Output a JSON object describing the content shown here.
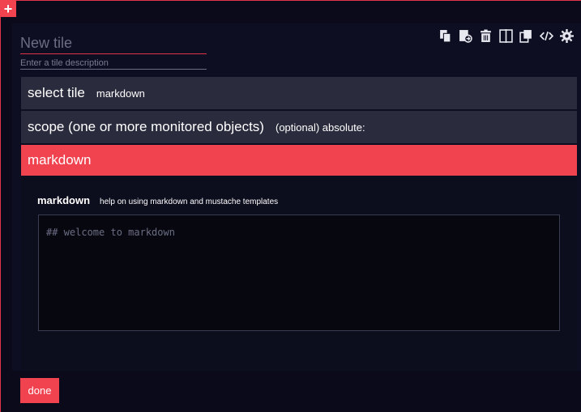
{
  "header": {
    "add_button_icon": "plus-icon",
    "accent_color": "#f0424f"
  },
  "tile": {
    "title_placeholder": "New tile",
    "description_placeholder": "Enter a tile description"
  },
  "toolbar": {
    "icons": [
      "copy-icon",
      "export-icon",
      "trash-icon",
      "split-icon",
      "duplicate-icon",
      "code-icon",
      "gear-icon"
    ]
  },
  "rows": {
    "select_tile_label": "select tile",
    "select_tile_value": "markdown",
    "scope_label": "scope (one or more monitored objects)",
    "scope_optional": "(optional) absolute:",
    "markdown_label": "markdown"
  },
  "markdown": {
    "title": "markdown",
    "help_link": "help on using markdown and mustache templates",
    "editor_placeholder": "## welcome to markdown"
  },
  "footer": {
    "done_label": "done"
  }
}
